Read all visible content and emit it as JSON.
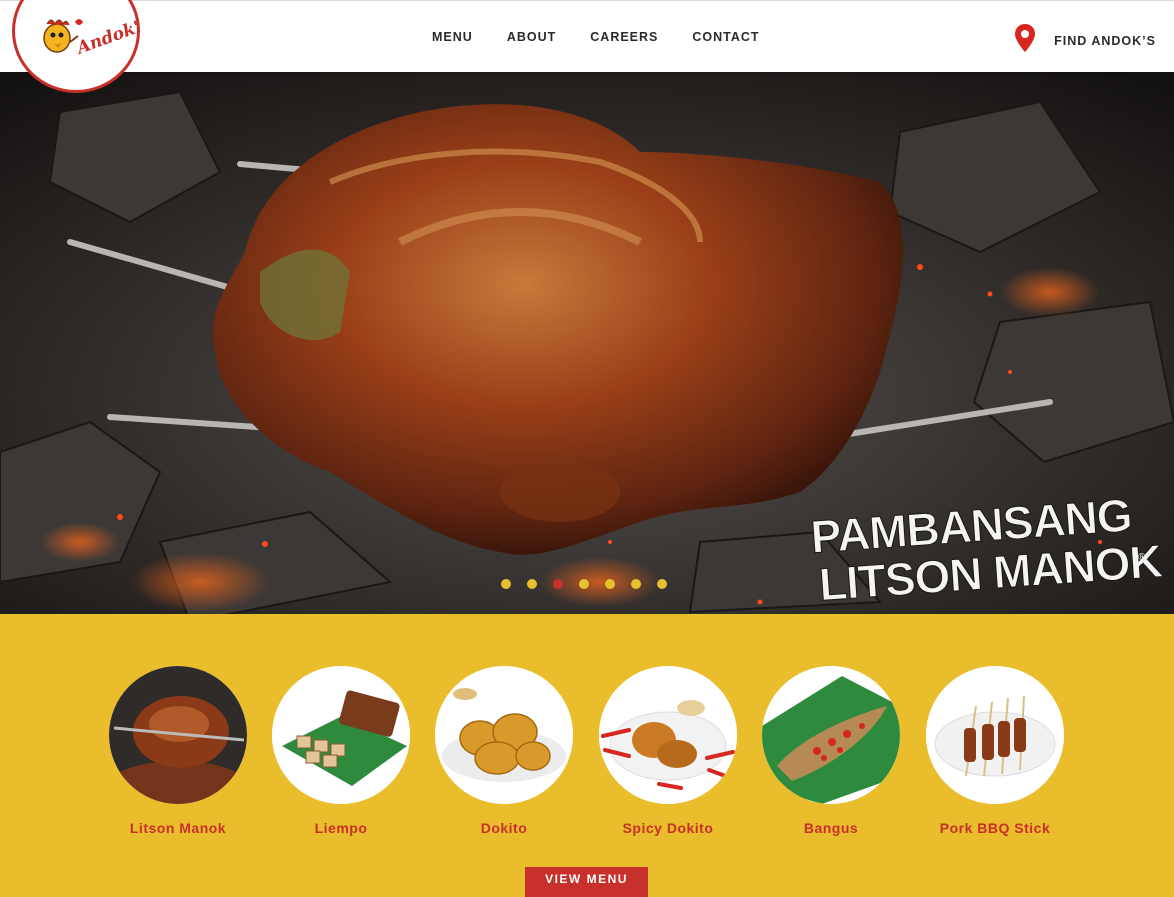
{
  "header": {
    "logo_text": "Andok's",
    "nav": [
      {
        "label": "MENU"
      },
      {
        "label": "ABOUT"
      },
      {
        "label": "CAREERS"
      },
      {
        "label": "CONTACT"
      }
    ],
    "find_label": "FIND ANDOK’S",
    "icons": {
      "find": "map-pin-icon"
    }
  },
  "hero": {
    "slogan_line1": "PAMBANSANG",
    "slogan_line2": "LITSON MANOK",
    "slogan_mark": "®",
    "slides_count": 7,
    "active_slide": 3
  },
  "menu": {
    "items": [
      {
        "name": "Litson Manok"
      },
      {
        "name": "Liempo"
      },
      {
        "name": "Dokito"
      },
      {
        "name": "Spicy Dokito"
      },
      {
        "name": "Bangus"
      },
      {
        "name": "Pork BBQ Stick"
      }
    ],
    "button_label": "VIEW MENU"
  },
  "colors": {
    "brand_red": "#c8312b",
    "brand_yellow": "#e9bd2b"
  }
}
